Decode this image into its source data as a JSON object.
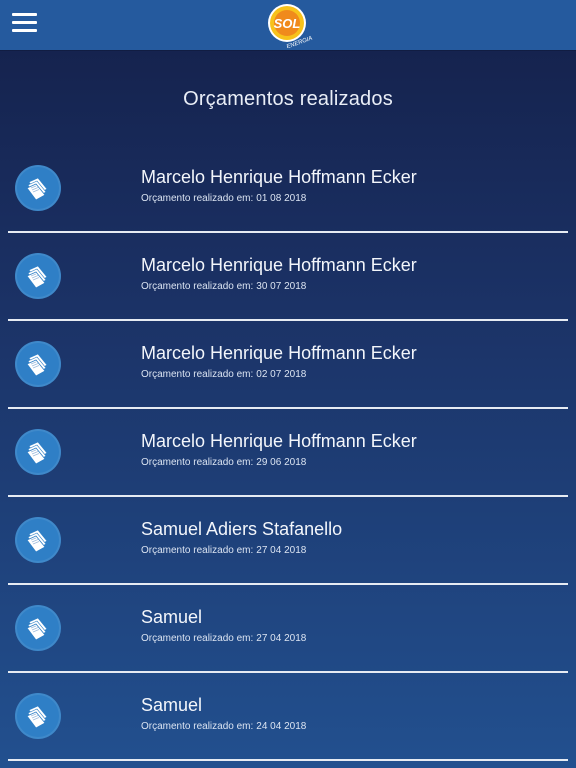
{
  "header": {
    "logo_text": "SOL",
    "logo_subtext": "ENERGIA"
  },
  "page": {
    "title": "Orçamentos realizados"
  },
  "list": {
    "meta_label": "Orçamento realizado em:",
    "items": [
      {
        "name": "Marcelo Henrique Hoffmann Ecker",
        "date": "01 08 2018"
      },
      {
        "name": "Marcelo Henrique Hoffmann Ecker",
        "date": "30 07 2018"
      },
      {
        "name": "Marcelo Henrique Hoffmann Ecker",
        "date": "02 07 2018"
      },
      {
        "name": "Marcelo Henrique Hoffmann Ecker",
        "date": "29 06 2018"
      },
      {
        "name": "Samuel Adiers Stafanello",
        "date": "27 04 2018"
      },
      {
        "name": "Samuel",
        "date": "27 04 2018"
      },
      {
        "name": "Samuel",
        "date": "24 04 2018"
      }
    ]
  },
  "colors": {
    "header_bg": "#255a9e",
    "icon_bg": "#2f7fc6",
    "logo_orange": "#f08a1c",
    "logo_yellow": "#f7c21b"
  },
  "icons": {
    "menu": "hamburger-menu-icon",
    "item": "documents-icon"
  }
}
